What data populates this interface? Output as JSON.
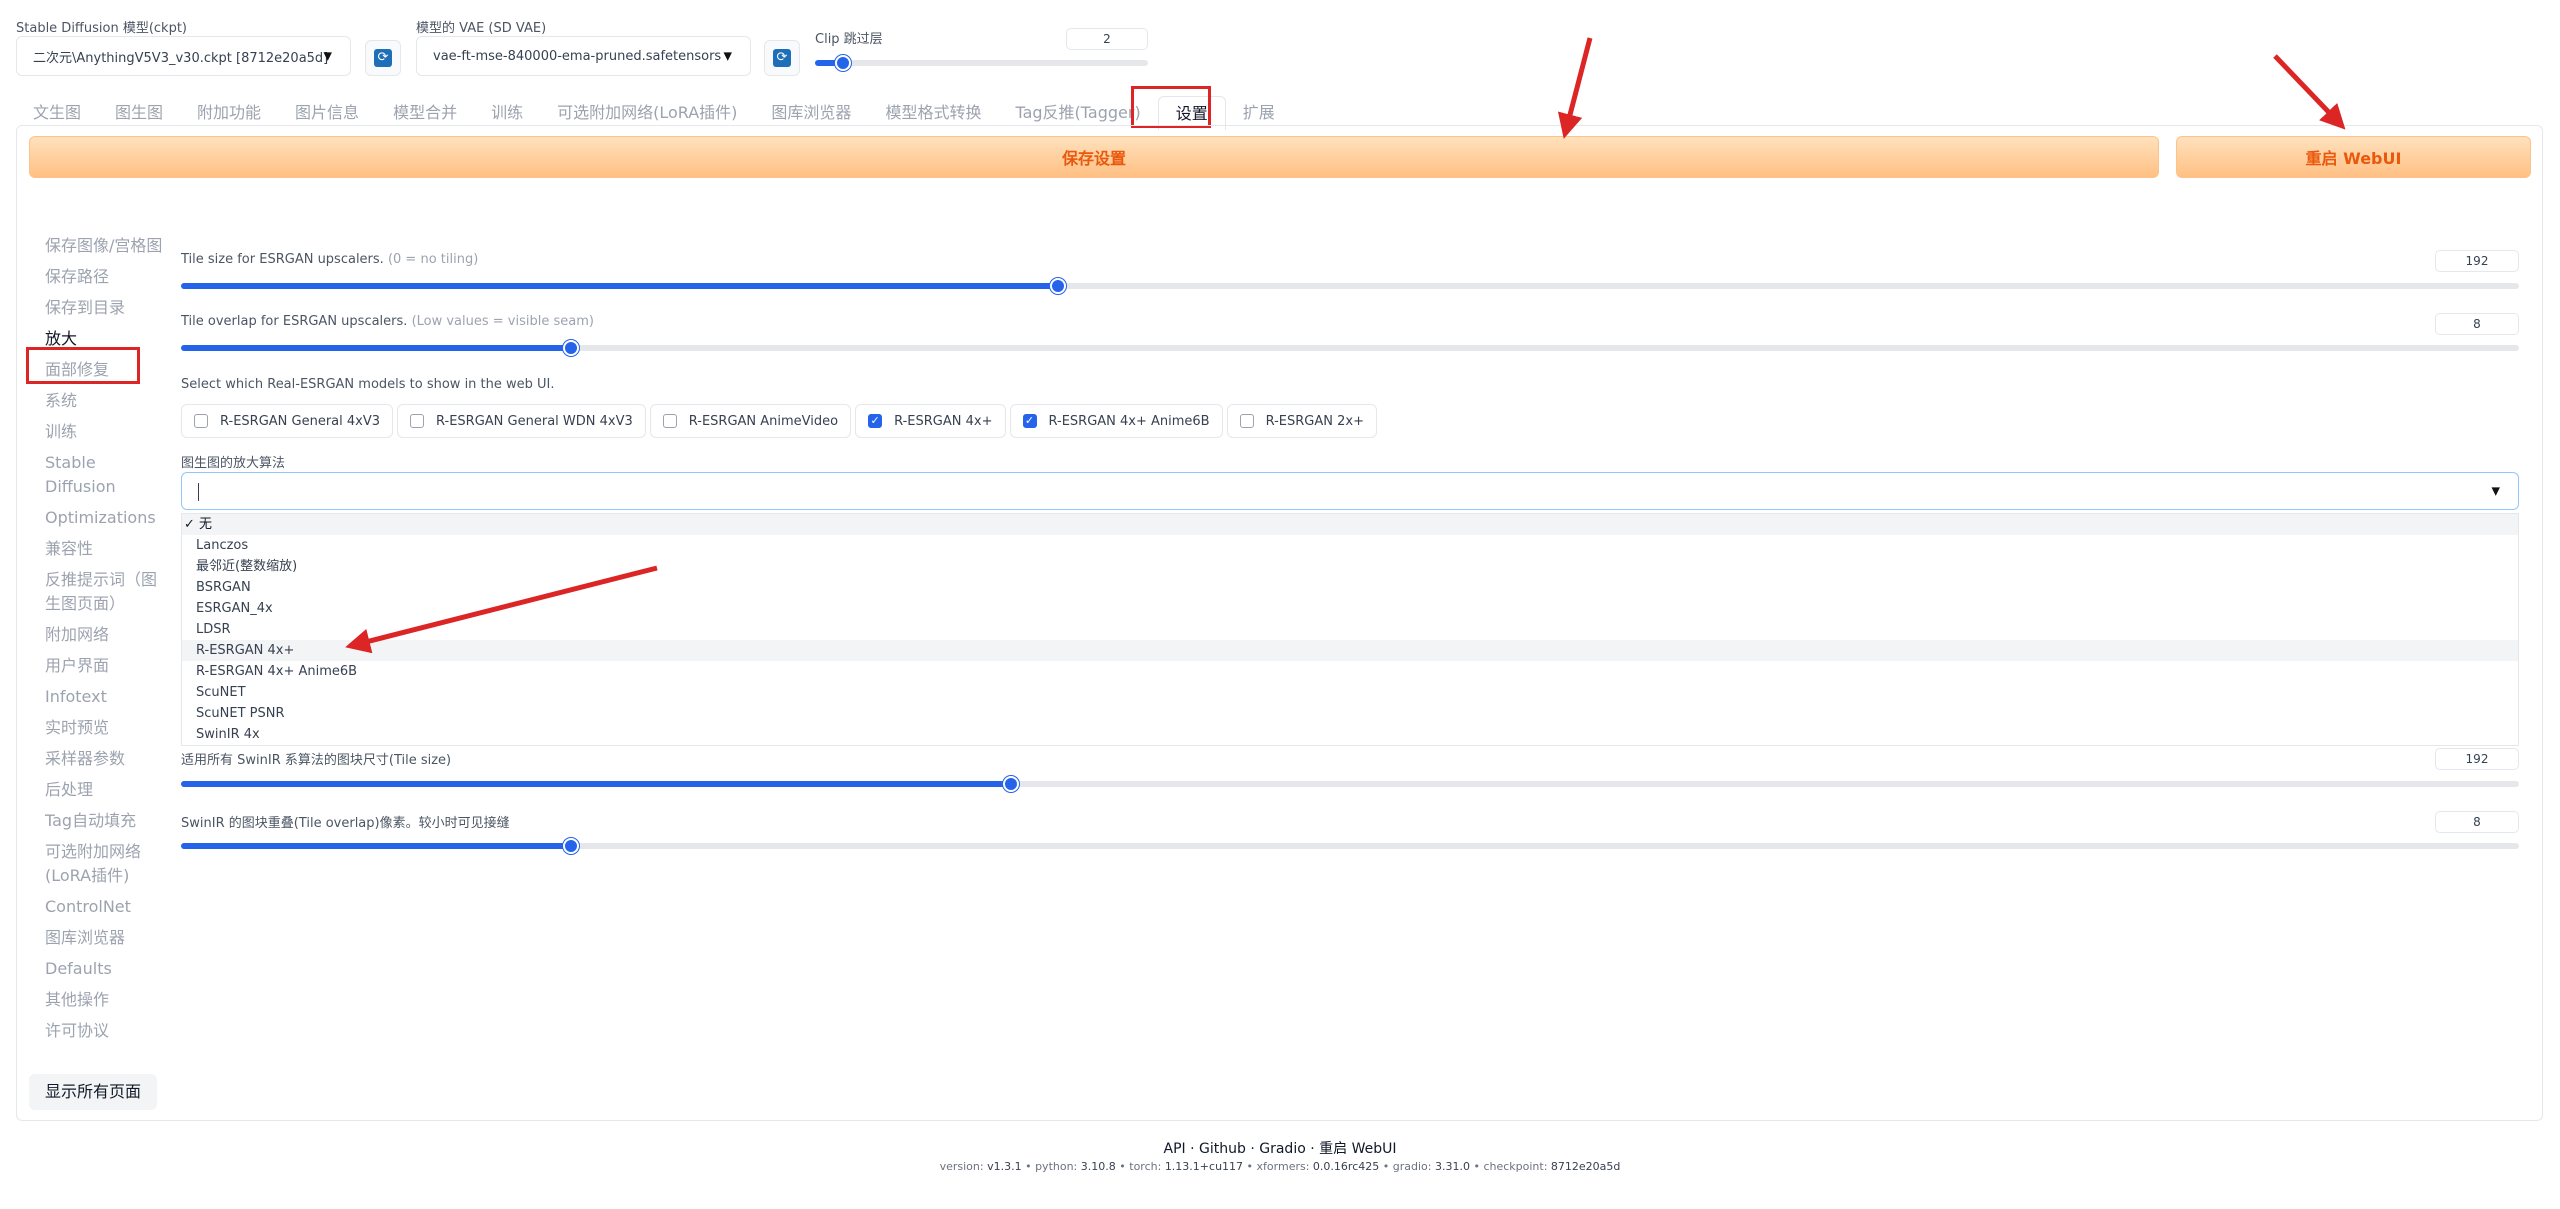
{
  "top": {
    "model_label": "Stable Diffusion 模型(ckpt)",
    "model_value": "二次元\\AnythingV5V3_v30.ckpt [8712e20a5d]",
    "vae_label": "模型的 VAE (SD VAE)",
    "vae_value": "vae-ft-mse-840000-ema-pruned.safetensors",
    "clip_label": "Clip 跳过层",
    "clip_value": "2",
    "clip_level": 0.0833
  },
  "tabs": [
    "文生图",
    "图生图",
    "附加功能",
    "图片信息",
    "模型合并",
    "训练",
    "可选附加网络(LoRA插件)",
    "图库浏览器",
    "模型格式转换",
    "Tag反推(Tagger)",
    "设置",
    "扩展"
  ],
  "active_tab": "设置",
  "buttons": {
    "save": "保存设置",
    "restart": "重启 WebUI"
  },
  "sidebar": {
    "items": [
      "保存图像/宫格图",
      "保存路径",
      "保存到目录",
      "放大",
      "面部修复",
      "系统",
      "训练",
      "Stable Diffusion",
      "Optimizations",
      "兼容性",
      "反推提示词（图生图页面）",
      "附加网络",
      "用户界面",
      "Infotext",
      "实时预览",
      "采样器参数",
      "后处理",
      "Tag自动填充",
      "可选附加网络(LoRA插件)",
      "ControlNet",
      "图库浏览器",
      "Defaults",
      "其他操作",
      "许可协议"
    ],
    "active": "放大",
    "show_all": "显示所有页面"
  },
  "settings": {
    "tile_size_label": "Tile size for ESRGAN upscalers.",
    "tile_size_hint": "(0 = no tiling)",
    "tile_size_value": "192",
    "tile_size_level": 0.375,
    "tile_overlap_label": "Tile overlap for ESRGAN upscalers.",
    "tile_overlap_hint": "(Low values = visible seam)",
    "tile_overlap_value": "8",
    "tile_overlap_level": 0.167,
    "realesrgan_label": "Select which Real-ESRGAN models to show in the web UI.",
    "realesrgan_models": [
      {
        "label": "R-ESRGAN General 4xV3",
        "checked": false
      },
      {
        "label": "R-ESRGAN General WDN 4xV3",
        "checked": false
      },
      {
        "label": "R-ESRGAN AnimeVideo",
        "checked": false
      },
      {
        "label": "R-ESRGAN 4x+",
        "checked": true
      },
      {
        "label": "R-ESRGAN 4x+ Anime6B",
        "checked": true
      },
      {
        "label": "R-ESRGAN 2x+",
        "checked": false
      }
    ],
    "img2img_upscaler_label": "图生图的放大算法",
    "dropdown_options": [
      "无",
      "Lanczos",
      "最邻近(整数缩放)",
      "BSRGAN",
      "ESRGAN_4x",
      "LDSR",
      "R-ESRGAN 4x+",
      "R-ESRGAN 4x+ Anime6B",
      "ScuNET",
      "ScuNET PSNR",
      "SwinIR 4x"
    ],
    "dropdown_selected": "无",
    "swinir_tile_label": "适用所有 SwinIR 系算法的图块尺寸(Tile size)",
    "swinir_tile_value": "192",
    "swinir_tile_level": 0.355,
    "swinir_overlap_label": "SwinIR 的图块重叠(Tile overlap)像素。较小时可见接缝",
    "swinir_overlap_value": "8",
    "swinir_overlap_level": 0.167
  },
  "footer": {
    "links": [
      "API",
      "Github",
      "Gradio",
      "重启 WebUI"
    ],
    "version_parts": [
      {
        "k": "version:",
        "v": "v1.3.1"
      },
      {
        "k": "python:",
        "v": "3.10.8"
      },
      {
        "k": "torch:",
        "v": "1.13.1+cu117"
      },
      {
        "k": "xformers:",
        "v": "0.0.16rc425"
      },
      {
        "k": "gradio:",
        "v": "3.31.0"
      },
      {
        "k": "checkpoint:",
        "v": "8712e20a5d"
      }
    ]
  },
  "colors": {
    "accent": "#2563eb",
    "orange_text": "#ea580c",
    "annotation_red": "#dc2626"
  },
  "icons": [
    "refresh-icon",
    "chevron-down-icon",
    "check-icon"
  ]
}
